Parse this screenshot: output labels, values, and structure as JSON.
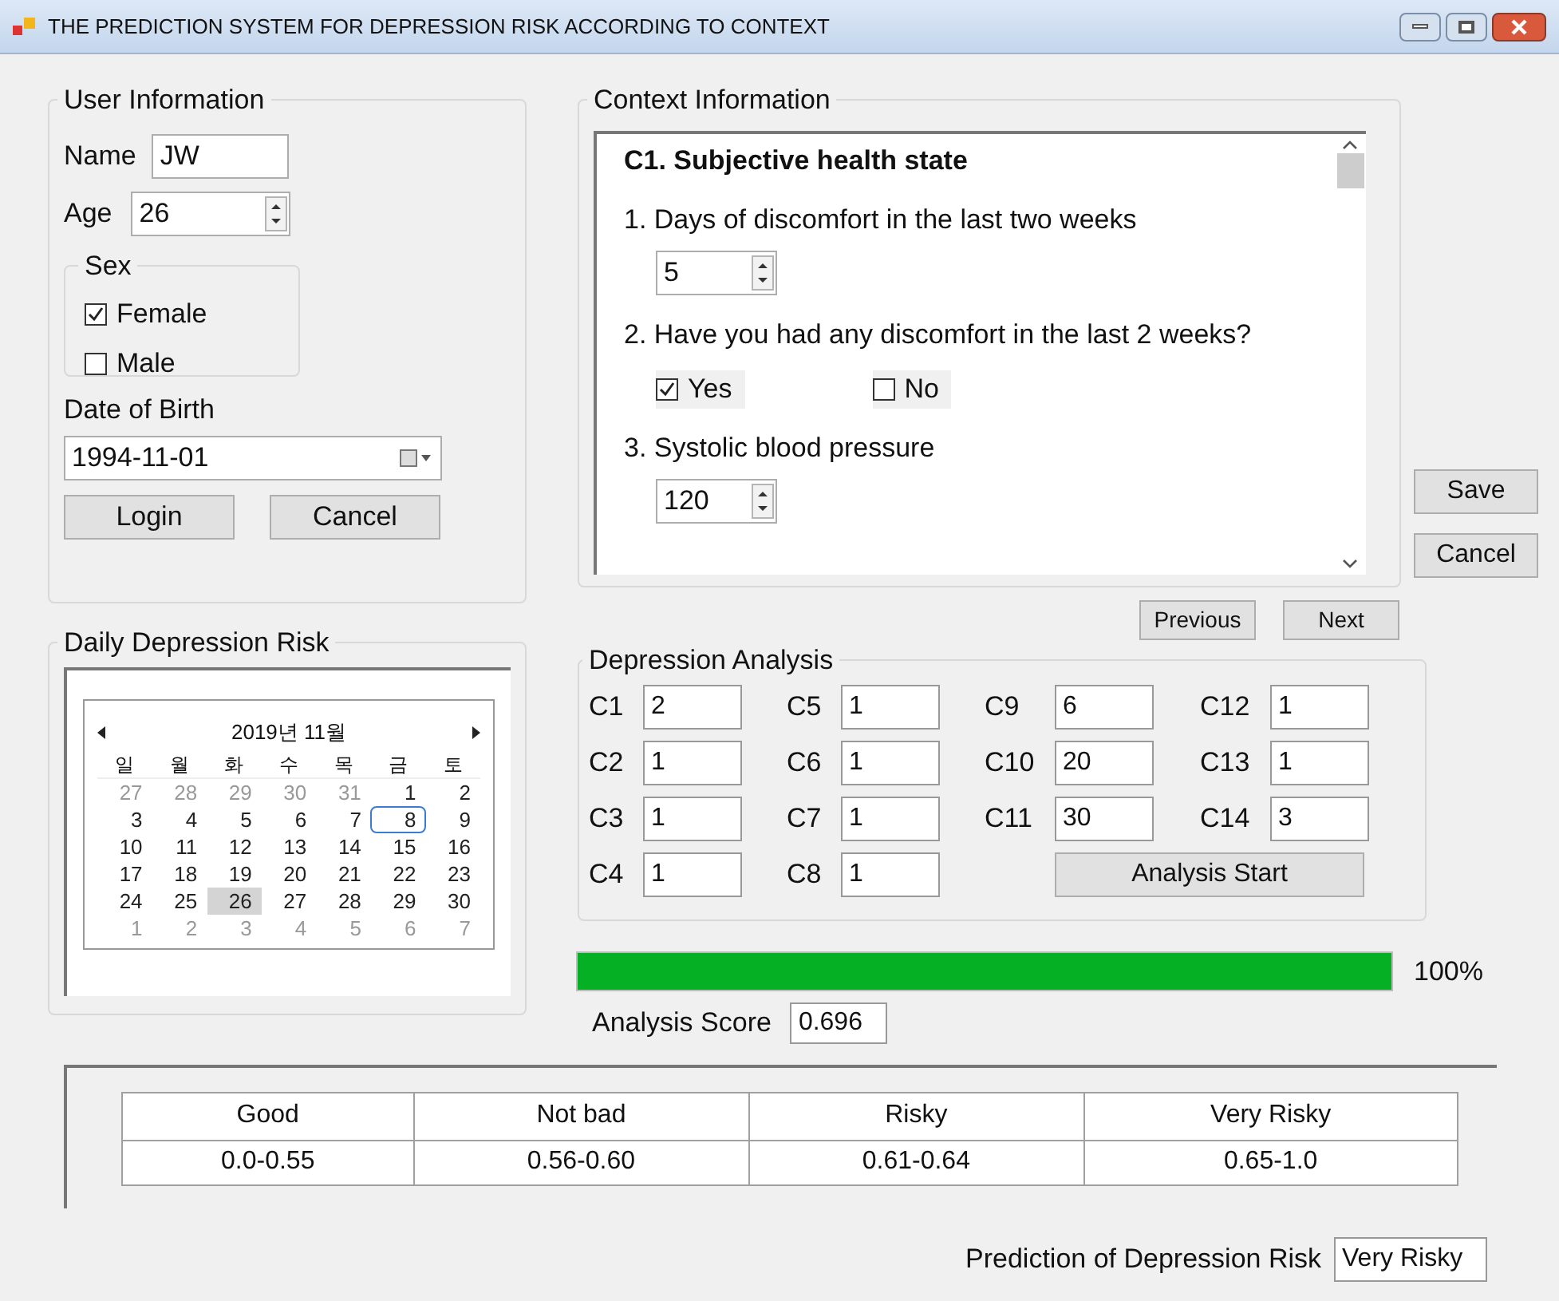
{
  "window": {
    "title": "THE PREDICTION SYSTEM FOR DEPRESSION RISK ACCORDING TO CONTEXT"
  },
  "user_info": {
    "title": "User Information",
    "name_label": "Name",
    "name_value": "JW",
    "age_label": "Age",
    "age_value": "26",
    "sex": {
      "title": "Sex",
      "options": [
        {
          "label": "Female",
          "checked": true
        },
        {
          "label": "Male",
          "checked": false
        }
      ]
    },
    "dob_label": "Date of Birth",
    "dob_value": "1994-11-01",
    "buttons": [
      "Login",
      "Cancel"
    ]
  },
  "daily_risk": {
    "title": "Daily Depression Risk",
    "calendar": {
      "month": "2019년 11월",
      "weekdays": [
        "일",
        "월",
        "화",
        "수",
        "목",
        "금",
        "토"
      ],
      "days": [
        {
          "label": "27",
          "muted": true,
          "selected": false,
          "focused": false
        },
        {
          "label": "28",
          "muted": true,
          "selected": false,
          "focused": false
        },
        {
          "label": "29",
          "muted": true,
          "selected": false,
          "focused": false
        },
        {
          "label": "30",
          "muted": true,
          "selected": false,
          "focused": false
        },
        {
          "label": "31",
          "muted": true,
          "selected": false,
          "focused": false
        },
        {
          "label": "1",
          "muted": false,
          "selected": false,
          "focused": false
        },
        {
          "label": "2",
          "muted": false,
          "selected": false,
          "focused": false
        },
        {
          "label": "3",
          "muted": false,
          "selected": false,
          "focused": false
        },
        {
          "label": "4",
          "muted": false,
          "selected": false,
          "focused": false
        },
        {
          "label": "5",
          "muted": false,
          "selected": false,
          "focused": false
        },
        {
          "label": "6",
          "muted": false,
          "selected": false,
          "focused": false
        },
        {
          "label": "7",
          "muted": false,
          "selected": false,
          "focused": false
        },
        {
          "label": "8",
          "muted": false,
          "selected": false,
          "focused": true
        },
        {
          "label": "9",
          "muted": false,
          "selected": false,
          "focused": false
        },
        {
          "label": "10",
          "muted": false,
          "selected": false,
          "focused": false
        },
        {
          "label": "11",
          "muted": false,
          "selected": false,
          "focused": false
        },
        {
          "label": "12",
          "muted": false,
          "selected": false,
          "focused": false
        },
        {
          "label": "13",
          "muted": false,
          "selected": false,
          "focused": false
        },
        {
          "label": "14",
          "muted": false,
          "selected": false,
          "focused": false
        },
        {
          "label": "15",
          "muted": false,
          "selected": false,
          "focused": false
        },
        {
          "label": "16",
          "muted": false,
          "selected": false,
          "focused": false
        },
        {
          "label": "17",
          "muted": false,
          "selected": false,
          "focused": false
        },
        {
          "label": "18",
          "muted": false,
          "selected": false,
          "focused": false
        },
        {
          "label": "19",
          "muted": false,
          "selected": false,
          "focused": false
        },
        {
          "label": "20",
          "muted": false,
          "selected": false,
          "focused": false
        },
        {
          "label": "21",
          "muted": false,
          "selected": false,
          "focused": false
        },
        {
          "label": "22",
          "muted": false,
          "selected": false,
          "focused": false
        },
        {
          "label": "23",
          "muted": false,
          "selected": false,
          "focused": false
        },
        {
          "label": "24",
          "muted": false,
          "selected": false,
          "focused": false
        },
        {
          "label": "25",
          "muted": false,
          "selected": false,
          "focused": false
        },
        {
          "label": "26",
          "muted": false,
          "selected": true,
          "focused": false
        },
        {
          "label": "27",
          "muted": false,
          "selected": false,
          "focused": false
        },
        {
          "label": "28",
          "muted": false,
          "selected": false,
          "focused": false
        },
        {
          "label": "29",
          "muted": false,
          "selected": false,
          "focused": false
        },
        {
          "label": "30",
          "muted": false,
          "selected": false,
          "focused": false
        },
        {
          "label": "1",
          "muted": true,
          "selected": false,
          "focused": false
        },
        {
          "label": "2",
          "muted": true,
          "selected": false,
          "focused": false
        },
        {
          "label": "3",
          "muted": true,
          "selected": false,
          "focused": false
        },
        {
          "label": "4",
          "muted": true,
          "selected": false,
          "focused": false
        },
        {
          "label": "5",
          "muted": true,
          "selected": false,
          "focused": false
        },
        {
          "label": "6",
          "muted": true,
          "selected": false,
          "focused": false
        },
        {
          "label": "7",
          "muted": true,
          "selected": false,
          "focused": false
        }
      ]
    }
  },
  "context": {
    "title": "Context Information",
    "section": "C1. Subjective health state",
    "questions": [
      {
        "kind": "number",
        "label": "1. Days of discomfort in the last two weeks",
        "value": "5"
      },
      {
        "kind": "choices",
        "label": "2. Have you had any discomfort in the last 2 weeks?",
        "options": [
          {
            "label": "Yes",
            "checked": true
          },
          {
            "label": "No",
            "checked": false
          }
        ]
      },
      {
        "kind": "number",
        "label": "3. Systolic blood pressure",
        "value": "120"
      }
    ]
  },
  "side_buttons": [
    "Save",
    "Cancel"
  ],
  "nav_buttons": [
    "Previous",
    "Next"
  ],
  "analysis": {
    "title": "Depression Analysis",
    "columns": [
      [
        {
          "label": "C1",
          "value": "2"
        },
        {
          "label": "C2",
          "value": "1"
        },
        {
          "label": "C3",
          "value": "1"
        },
        {
          "label": "C4",
          "value": "1"
        }
      ],
      [
        {
          "label": "C5",
          "value": "1"
        },
        {
          "label": "C6",
          "value": "1"
        },
        {
          "label": "C7",
          "value": "1"
        },
        {
          "label": "C8",
          "value": "1"
        }
      ],
      [
        {
          "label": "C9",
          "value": "6"
        },
        {
          "label": "C10",
          "value": "20"
        },
        {
          "label": "C11",
          "value": "30"
        }
      ],
      [
        {
          "label": "C12",
          "value": "1"
        },
        {
          "label": "C13",
          "value": "1"
        },
        {
          "label": "C14",
          "value": "3"
        }
      ]
    ],
    "start_button": "Analysis Start"
  },
  "progress": {
    "level": 1,
    "reading": "100%"
  },
  "score": {
    "label": "Analysis Score",
    "value": "0.696"
  },
  "risk_table": {
    "columns": [
      "Good",
      "Not bad",
      "Risky",
      "Very Risky"
    ],
    "rows": [
      [
        "0.0-0.55",
        "0.56-0.60",
        "0.61-0.64",
        "0.65-1.0"
      ]
    ]
  },
  "prediction": {
    "label": "Prediction of Depression Risk",
    "value": "Very Risky"
  }
}
